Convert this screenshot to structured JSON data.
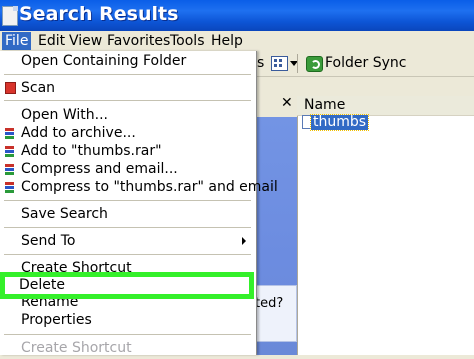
{
  "window": {
    "title": "Search Results"
  },
  "menubar": {
    "items": [
      {
        "label": "File",
        "active": true
      },
      {
        "label": "Edit"
      },
      {
        "label": "View"
      },
      {
        "label": "Favorites"
      },
      {
        "label": "Tools"
      },
      {
        "label": "Help"
      }
    ]
  },
  "toolbar": {
    "partial_label": "s",
    "views_icon": "views-icon",
    "folder_sync_label": "Folder Sync"
  },
  "left_pane": {
    "partial_text": "ted?"
  },
  "file_list": {
    "column_header": "Name",
    "items": [
      {
        "name": "thumbs",
        "selected": true
      }
    ]
  },
  "file_menu": {
    "items": [
      {
        "label": "Open Containing Folder"
      },
      {
        "label": "Scan",
        "icon": "scan-icon"
      },
      {
        "label": "Open With..."
      },
      {
        "label": "Add to archive...",
        "icon": "winrar-icon"
      },
      {
        "label": "Add to \"thumbs.rar\"",
        "icon": "winrar-icon"
      },
      {
        "label": "Compress and email...",
        "icon": "winrar-icon"
      },
      {
        "label": "Compress to \"thumbs.rar\" and email",
        "icon": "winrar-icon"
      },
      {
        "label": "Save Search"
      },
      {
        "label": "Send To",
        "submenu": true
      },
      {
        "label": "Create Shortcut"
      },
      {
        "label": "Delete",
        "highlighted": true
      },
      {
        "label": "Rename"
      },
      {
        "label": "Properties"
      },
      {
        "label": "Create Shortcut",
        "disabled": true
      }
    ]
  },
  "colors": {
    "title_bar": "#0a5ee8",
    "selection": "#316ac5",
    "highlight_outline": "#34f02a",
    "menu_background": "#ffffff"
  }
}
